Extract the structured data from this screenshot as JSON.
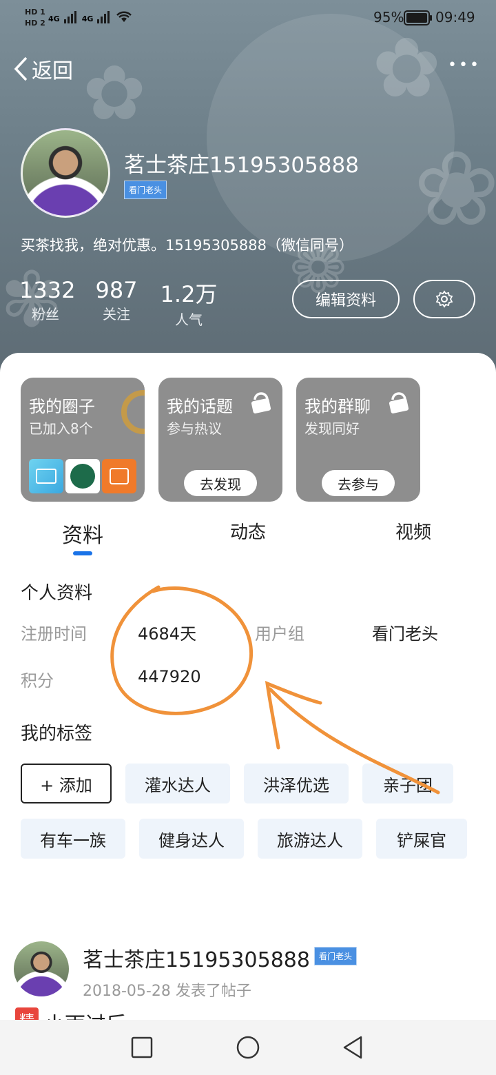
{
  "status_bar": {
    "sim1": "HD 1",
    "sim2": "HD 2",
    "net1": "4G",
    "net2": "4G",
    "battery": "95%",
    "time": "09:49"
  },
  "topbar": {
    "back_label": "返回",
    "more_label": "•••"
  },
  "profile": {
    "name": "茗士茶庄15195305888",
    "badge": "看门老头",
    "bio": "买茶找我，绝对优惠。15195305888（微信同号）",
    "stats": [
      {
        "value": "1332",
        "label": "粉丝"
      },
      {
        "value": "987",
        "label": "关注"
      },
      {
        "value": "1.2万",
        "label": "人气"
      }
    ],
    "edit_button": "编辑资料"
  },
  "cards": [
    {
      "title": "我的圈子",
      "sub": "已加入8个"
    },
    {
      "title": "我的话题",
      "sub": "参与热议",
      "button": "去发现"
    },
    {
      "title": "我的群聊",
      "sub": "发现同好",
      "button": "去参与"
    }
  ],
  "tabs": [
    "资料",
    "动态",
    "视频"
  ],
  "info": {
    "section_title": "个人资料",
    "reg_label": "注册时间",
    "reg_value": "4684天",
    "group_label": "用户组",
    "group_value": "看门老头",
    "points_label": "积分",
    "points_value": "447920"
  },
  "tags": {
    "section_title": "我的标签",
    "add_label": "+ 添加",
    "items": [
      "灌水达人",
      "洪泽优选",
      "亲子团",
      "有车一族",
      "健身达人",
      "旅游达人",
      "铲屎官"
    ]
  },
  "feed": {
    "name": "茗士茶庄15195305888",
    "badge": "看门老头",
    "meta": "2018-05-28 发表了帖子",
    "flag": "精",
    "title_partial": "小雨过后"
  },
  "colors": {
    "accent": "#1a73e8",
    "annotation": "#f0923a",
    "card_bg": "#8e8e8e",
    "tag_bg": "#eef4fb"
  }
}
